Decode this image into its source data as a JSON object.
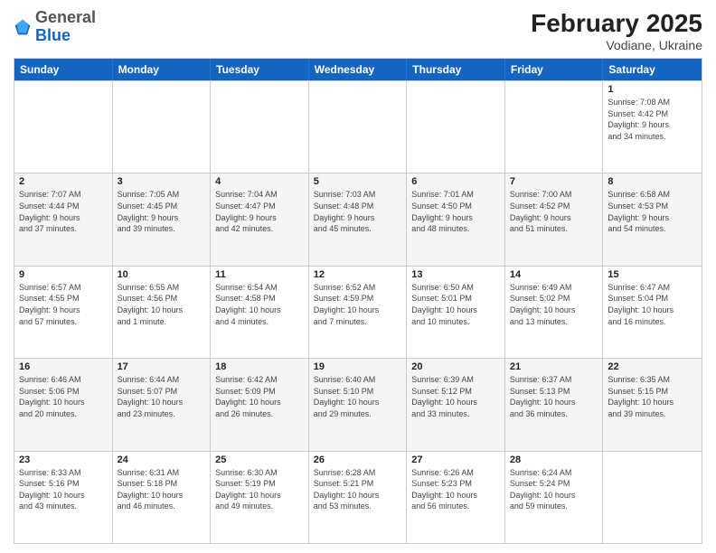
{
  "header": {
    "logo_general": "General",
    "logo_blue": "Blue",
    "month_title": "February 2025",
    "location": "Vodiane, Ukraine"
  },
  "days_of_week": [
    "Sunday",
    "Monday",
    "Tuesday",
    "Wednesday",
    "Thursday",
    "Friday",
    "Saturday"
  ],
  "weeks": [
    {
      "alt": false,
      "cells": [
        {
          "day": "",
          "info": ""
        },
        {
          "day": "",
          "info": ""
        },
        {
          "day": "",
          "info": ""
        },
        {
          "day": "",
          "info": ""
        },
        {
          "day": "",
          "info": ""
        },
        {
          "day": "",
          "info": ""
        },
        {
          "day": "1",
          "info": "Sunrise: 7:08 AM\nSunset: 4:42 PM\nDaylight: 9 hours\nand 34 minutes."
        }
      ]
    },
    {
      "alt": true,
      "cells": [
        {
          "day": "2",
          "info": "Sunrise: 7:07 AM\nSunset: 4:44 PM\nDaylight: 9 hours\nand 37 minutes."
        },
        {
          "day": "3",
          "info": "Sunrise: 7:05 AM\nSunset: 4:45 PM\nDaylight: 9 hours\nand 39 minutes."
        },
        {
          "day": "4",
          "info": "Sunrise: 7:04 AM\nSunset: 4:47 PM\nDaylight: 9 hours\nand 42 minutes."
        },
        {
          "day": "5",
          "info": "Sunrise: 7:03 AM\nSunset: 4:48 PM\nDaylight: 9 hours\nand 45 minutes."
        },
        {
          "day": "6",
          "info": "Sunrise: 7:01 AM\nSunset: 4:50 PM\nDaylight: 9 hours\nand 48 minutes."
        },
        {
          "day": "7",
          "info": "Sunrise: 7:00 AM\nSunset: 4:52 PM\nDaylight: 9 hours\nand 51 minutes."
        },
        {
          "day": "8",
          "info": "Sunrise: 6:58 AM\nSunset: 4:53 PM\nDaylight: 9 hours\nand 54 minutes."
        }
      ]
    },
    {
      "alt": false,
      "cells": [
        {
          "day": "9",
          "info": "Sunrise: 6:57 AM\nSunset: 4:55 PM\nDaylight: 9 hours\nand 57 minutes."
        },
        {
          "day": "10",
          "info": "Sunrise: 6:55 AM\nSunset: 4:56 PM\nDaylight: 10 hours\nand 1 minute."
        },
        {
          "day": "11",
          "info": "Sunrise: 6:54 AM\nSunset: 4:58 PM\nDaylight: 10 hours\nand 4 minutes."
        },
        {
          "day": "12",
          "info": "Sunrise: 6:52 AM\nSunset: 4:59 PM\nDaylight: 10 hours\nand 7 minutes."
        },
        {
          "day": "13",
          "info": "Sunrise: 6:50 AM\nSunset: 5:01 PM\nDaylight: 10 hours\nand 10 minutes."
        },
        {
          "day": "14",
          "info": "Sunrise: 6:49 AM\nSunset: 5:02 PM\nDaylight: 10 hours\nand 13 minutes."
        },
        {
          "day": "15",
          "info": "Sunrise: 6:47 AM\nSunset: 5:04 PM\nDaylight: 10 hours\nand 16 minutes."
        }
      ]
    },
    {
      "alt": true,
      "cells": [
        {
          "day": "16",
          "info": "Sunrise: 6:46 AM\nSunset: 5:06 PM\nDaylight: 10 hours\nand 20 minutes."
        },
        {
          "day": "17",
          "info": "Sunrise: 6:44 AM\nSunset: 5:07 PM\nDaylight: 10 hours\nand 23 minutes."
        },
        {
          "day": "18",
          "info": "Sunrise: 6:42 AM\nSunset: 5:09 PM\nDaylight: 10 hours\nand 26 minutes."
        },
        {
          "day": "19",
          "info": "Sunrise: 6:40 AM\nSunset: 5:10 PM\nDaylight: 10 hours\nand 29 minutes."
        },
        {
          "day": "20",
          "info": "Sunrise: 6:39 AM\nSunset: 5:12 PM\nDaylight: 10 hours\nand 33 minutes."
        },
        {
          "day": "21",
          "info": "Sunrise: 6:37 AM\nSunset: 5:13 PM\nDaylight: 10 hours\nand 36 minutes."
        },
        {
          "day": "22",
          "info": "Sunrise: 6:35 AM\nSunset: 5:15 PM\nDaylight: 10 hours\nand 39 minutes."
        }
      ]
    },
    {
      "alt": false,
      "cells": [
        {
          "day": "23",
          "info": "Sunrise: 6:33 AM\nSunset: 5:16 PM\nDaylight: 10 hours\nand 43 minutes."
        },
        {
          "day": "24",
          "info": "Sunrise: 6:31 AM\nSunset: 5:18 PM\nDaylight: 10 hours\nand 46 minutes."
        },
        {
          "day": "25",
          "info": "Sunrise: 6:30 AM\nSunset: 5:19 PM\nDaylight: 10 hours\nand 49 minutes."
        },
        {
          "day": "26",
          "info": "Sunrise: 6:28 AM\nSunset: 5:21 PM\nDaylight: 10 hours\nand 53 minutes."
        },
        {
          "day": "27",
          "info": "Sunrise: 6:26 AM\nSunset: 5:23 PM\nDaylight: 10 hours\nand 56 minutes."
        },
        {
          "day": "28",
          "info": "Sunrise: 6:24 AM\nSunset: 5:24 PM\nDaylight: 10 hours\nand 59 minutes."
        },
        {
          "day": "",
          "info": ""
        }
      ]
    }
  ]
}
